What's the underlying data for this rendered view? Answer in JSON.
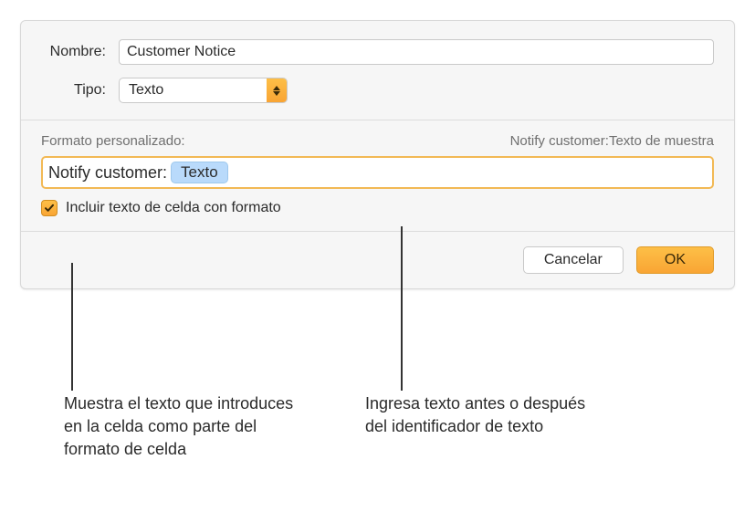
{
  "labels": {
    "name": "Nombre:",
    "type": "Tipo:"
  },
  "nameValue": "Customer Notice",
  "typeValue": "Texto",
  "formatSection": {
    "title": "Formato personalizado:",
    "preview": "Notify customer:Texto de muestra",
    "prefixText": "Notify customer: ",
    "tokenLabel": "Texto",
    "checkboxLabel": "Incluir texto de celda con formato"
  },
  "buttons": {
    "cancel": "Cancelar",
    "ok": "OK"
  },
  "callouts": {
    "left": "Muestra el texto que introduces en la celda como parte del formato de celda",
    "right": "Ingresa texto antes o después del identificador de texto"
  }
}
